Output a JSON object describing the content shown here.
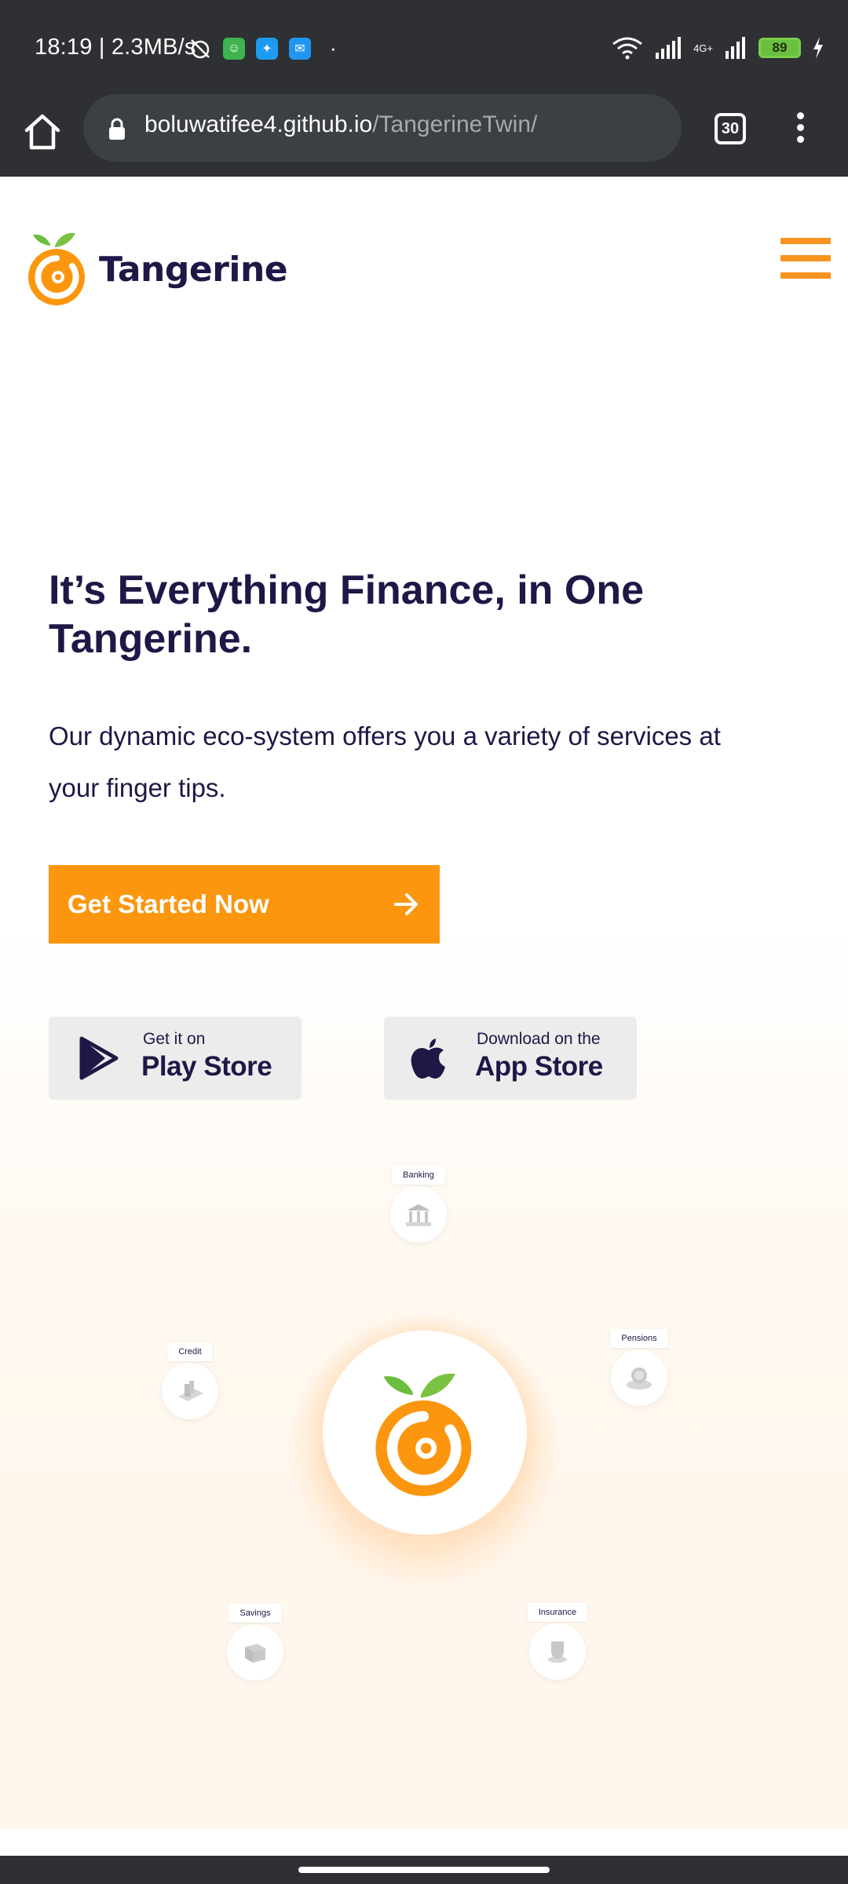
{
  "status_bar": {
    "time_speed": "18:19 | 2.3MB/s",
    "network_label": "4G+",
    "battery": "89",
    "dot": "·"
  },
  "browser": {
    "url_host": "boluwatifee4.github.io",
    "url_path": "/TangerineTwin/",
    "tab_count": "30"
  },
  "header": {
    "brand": "Tangerine"
  },
  "hero": {
    "title": "It’s Everything Finance, in One Tangerine.",
    "subtitle": "Our dynamic eco-system offers you a variety of services at your finger tips.",
    "cta_label": "Get Started Now"
  },
  "stores": {
    "play": {
      "small": "Get it on",
      "big": "Play Store"
    },
    "apple": {
      "small": "Download on the",
      "big": "App Store"
    }
  },
  "services": {
    "banking": "Banking",
    "pensions": "Pensions",
    "credit": "Credit",
    "savings": "Savings",
    "insurance": "Insurance"
  },
  "colors": {
    "brand_orange": "#fb960e",
    "brand_navy": "#1f1746",
    "leaf_green": "#6abf3e",
    "chrome_dark": "#2e3033"
  }
}
